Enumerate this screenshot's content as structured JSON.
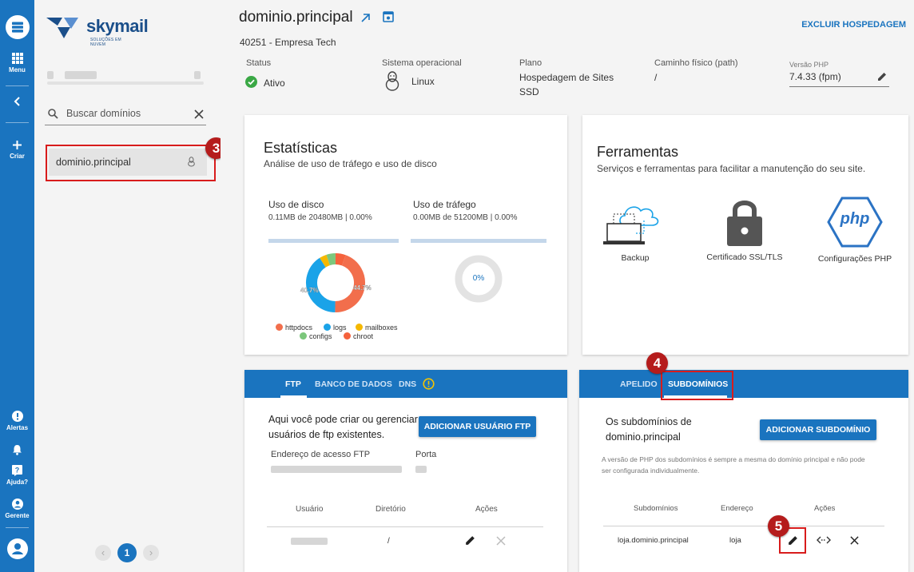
{
  "rail": {
    "menu_label": "Menu",
    "create_label": "Criar",
    "alerts_label": "Alertas",
    "help_label": "Ajuda?",
    "manager_label": "Gerente"
  },
  "logo": {
    "name": "skymail",
    "tagline": "SOLUÇÕES EM NUVEM"
  },
  "domains": {
    "search_placeholder": "Buscar domínios",
    "items": [
      {
        "name": "dominio.principal"
      }
    ],
    "pager": {
      "current": "1"
    }
  },
  "header": {
    "title": "dominio.principal",
    "subtitle": "40251 - Empresa Tech",
    "delete_label": "EXCLUIR HOSPEDAGEM",
    "status_label": "Status",
    "status_value": "Ativo",
    "os_label": "Sistema operacional",
    "os_value": "Linux",
    "plan_label": "Plano",
    "plan_value_line1": "Hospedagem de Sites",
    "plan_value_line2": "SSD",
    "path_label": "Caminho físico (path)",
    "path_value": "/",
    "php_label": "Versão PHP",
    "php_value": "7.4.33 (fpm)"
  },
  "stats": {
    "title": "Estatísticas",
    "subtitle": "Análise de uso de tráfego e uso de disco",
    "disk_label": "Uso de disco",
    "disk_value": "0.11MB de 20480MB | 0.00%",
    "traffic_label": "Uso de tráfego",
    "traffic_value": "0.00MB de 51200MB | 0.00%",
    "traffic_center": "0%",
    "disk_usage_fraction": 0.0,
    "traffic_usage_fraction": 0.0
  },
  "chart_data": {
    "type": "pie",
    "categories": [
      "httpdocs",
      "logs",
      "mailboxes",
      "configs",
      "chroot"
    ],
    "values": [
      44.7,
      40.7,
      4.0,
      5.0,
      5.6
    ],
    "labels_shown": [
      "44.7%",
      "40.7%"
    ],
    "colors": [
      "#f26e4c",
      "#1aa3e8",
      "#f5b800",
      "#7cc77c",
      "#f5623c"
    ],
    "legend_position": "bottom"
  },
  "tools": {
    "title": "Ferramentas",
    "subtitle": "Serviços e ferramentas para facilitar a manutenção do seu site.",
    "backup_label": "Backup",
    "ssl_label": "Certificado SSL/TLS",
    "php_label": "Configurações PHP",
    "php_logo_text": "php"
  },
  "ftp": {
    "tabs": [
      "FTP",
      "BANCO DE DADOS",
      "DNS"
    ],
    "description_line1": "Aqui você pode criar ou gerenciar",
    "description_line2": "usuários de ftp existentes.",
    "add_button": "ADICIONAR USUÁRIO FTP",
    "address_label": "Endereço de acesso FTP",
    "port_label": "Porta",
    "col_user": "Usuário",
    "col_dir": "Diretório",
    "col_actions": "Ações",
    "row_dir": "/"
  },
  "subdomains": {
    "tabs": [
      "APELIDO",
      "SUBDOMÍNIOS"
    ],
    "description_line1": "Os subdomínios de",
    "description_line2": "dominio.principal",
    "add_button": "ADICIONAR SUBDOMÍNIO",
    "note_line1": "A versão de PHP dos subdomínios é sempre a mesma do domínio principal e não pode",
    "note_line2": "ser configurada individualmente.",
    "col_sub": "Subdomínios",
    "col_addr": "Endereço",
    "col_actions": "Ações",
    "row_name": "loja.dominio.principal",
    "row_addr": "loja"
  },
  "annotations": {
    "step3": "3",
    "step4": "4",
    "step5": "5"
  },
  "colors": {
    "primary": "#1a74bf",
    "highlight_red": "#d81c1c",
    "badge_red": "#b51c1c",
    "status_green": "#3aa845"
  }
}
